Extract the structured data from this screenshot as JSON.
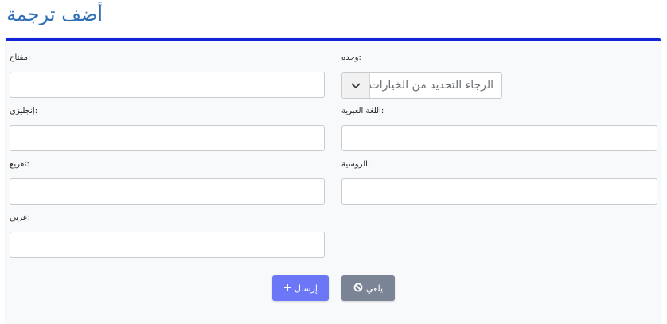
{
  "page": {
    "title": "أضف ترجمة"
  },
  "form": {
    "unit": {
      "label": ":وحده",
      "placeholder": "الرجاء التحديد من الخيارات"
    },
    "key": {
      "label": ":مفتاح",
      "value": ""
    },
    "hebrew": {
      "label": ":اللغة العبرية",
      "value": ""
    },
    "english": {
      "label": ":إنجليزي",
      "value": ""
    },
    "russian": {
      "label": ":الروسية",
      "value": ""
    },
    "tigrinya": {
      "label": ":تقريع",
      "value": ""
    },
    "arabic": {
      "label": ":عربي",
      "value": ""
    }
  },
  "actions": {
    "submit_label": "إرسال",
    "cancel_label": "يلغي"
  },
  "icons": {
    "submit": "plus-icon",
    "cancel": "ban-icon",
    "select": "chevron-down-icon"
  },
  "colors": {
    "accent": "#1224d8",
    "title": "#2f6fb6",
    "submit": "#6c77f7",
    "cancel": "#7a8494"
  }
}
